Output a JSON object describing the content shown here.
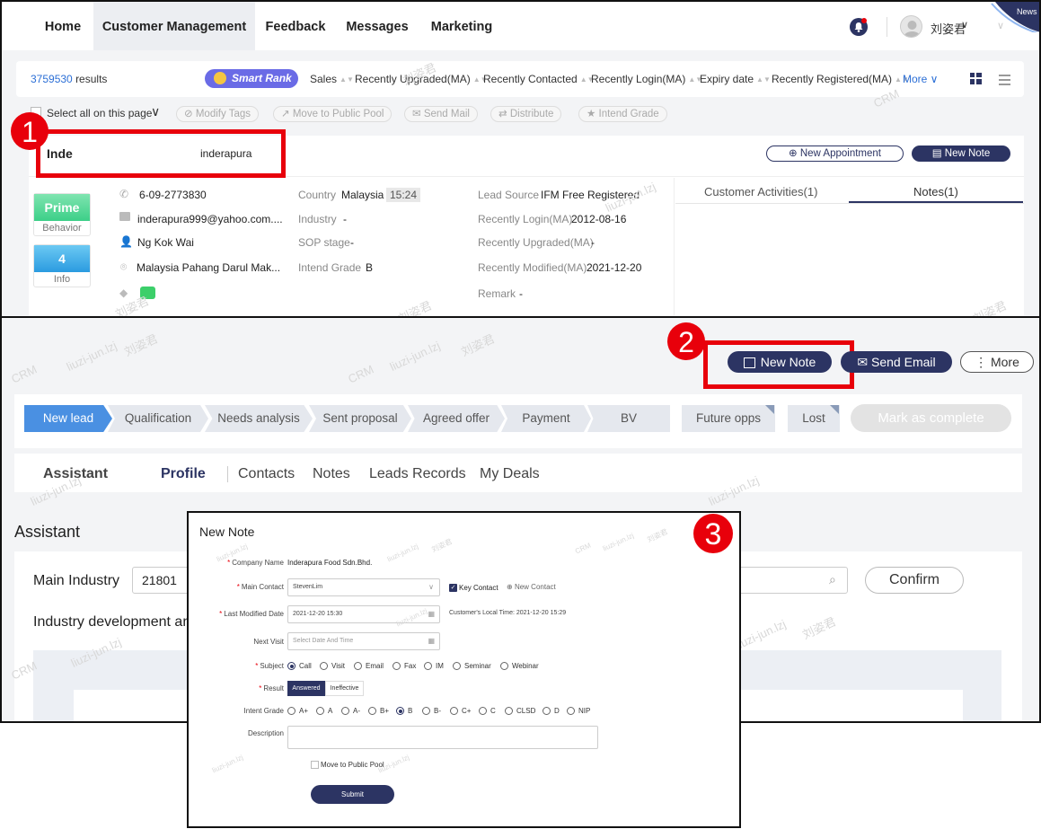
{
  "panel1": {
    "nav": {
      "tabs": [
        "Home",
        "Customer Management",
        "Feedback",
        "Messages",
        "Marketing"
      ],
      "news_label": "News",
      "user_name": "刘姿君"
    },
    "toolbar": {
      "results_count": "3759530",
      "results_label": "results",
      "smart_rank_label": "Smart Rank",
      "sort_options": [
        "Sales",
        "Recently Upgraded(MA)",
        "Recently Contacted",
        "Recently Login(MA)",
        "Expiry date",
        "Recently Registered(MA)"
      ],
      "more_label": "More"
    },
    "bulk": {
      "select_all_label": "Select all on this page",
      "actions": [
        "Modify Tags",
        "Move to Public Pool",
        "Send Mail",
        "Distribute",
        "Intend Grade"
      ]
    },
    "customer": {
      "name_short": "Inde",
      "name_full": "inderapura",
      "new_appointment_label": "New Appointment",
      "new_note_label": "New Note",
      "prime_label": "Prime",
      "behavior_label": "Behavior",
      "info_count": "4",
      "info_label": "Info",
      "phone": "6-09-2773830",
      "email": "inderapura999@yahoo.com....",
      "contact_name": "Ng Kok Wai",
      "address": "Malaysia Pahang Darul Mak...",
      "country_label": "Country",
      "country_value": "Malaysia",
      "local_time": "15:24",
      "industry_label": "Industry",
      "industry_value": "-",
      "sop_label": "SOP stage",
      "sop_value": "-",
      "intend_label": "Intend Grade",
      "intend_value": "B",
      "lead_source_label": "Lead Source",
      "lead_source_value": "IFM Free Registered",
      "recent_login_label": "Recently Login(MA)",
      "recent_login_value": "2012-08-16",
      "recent_upgraded_label": "Recently Upgraded(MA)",
      "recent_upgraded_value": "-",
      "recent_modified_label": "Recently Modified(MA)",
      "recent_modified_value": "2021-12-20",
      "remark_label": "Remark",
      "remark_value": "-",
      "tab_activities": "Customer Activities(1)",
      "tab_notes": "Notes(1)"
    },
    "step_badge": "1"
  },
  "panel2": {
    "step_badge": "2",
    "actions": {
      "new_note": "New Note",
      "send_email": "Send Email",
      "more": "More"
    },
    "stages": [
      "New lead",
      "Qualification",
      "Needs analysis",
      "Sent proposal",
      "Agreed offer",
      "Payment",
      "BV"
    ],
    "future_opps": "Future opps",
    "lost": "Lost",
    "mark_complete": "Mark as complete",
    "subtabs": {
      "assistant": "Assistant",
      "profile": "Profile",
      "others": [
        "Contacts",
        "Notes",
        "Leads Records",
        "My Deals"
      ]
    },
    "section_title": "Assistant",
    "main_industry_label": "Main Industry",
    "main_industry_value": "21801",
    "confirm_label": "Confirm",
    "industry_dev_label": "Industry development an"
  },
  "panel3": {
    "step_badge": "3",
    "title": "New Note",
    "company_label": "Company Name",
    "company_value": "Inderapura Food Sdn.Bhd.",
    "main_contact_label": "Main Contact",
    "main_contact_value": "StevenLim",
    "key_contact_label": "Key Contact",
    "new_contact_label": "New Contact",
    "last_modified_label": "Last Modified Date",
    "last_modified_value": "2021-12-20 15:30",
    "local_time_text": "Customer's Local Time: 2021-12-20 15:29",
    "next_visit_label": "Next Visit",
    "next_visit_placeholder": "Select Date And Time",
    "subject_label": "Subject",
    "subject_options": [
      "Call",
      "Visit",
      "Email",
      "Fax",
      "IM",
      "Seminar",
      "Webinar"
    ],
    "result_label": "Result",
    "result_answered": "Answered",
    "result_ineffective": "Ineffective",
    "intent_label": "Intent Grade",
    "intent_options": [
      "A+",
      "A",
      "A-",
      "B+",
      "B",
      "B-",
      "C+",
      "C",
      "CLSD",
      "D",
      "NIP"
    ],
    "description_label": "Description",
    "move_pool_label": "Move to Public Pool",
    "submit_label": "Submit"
  },
  "watermark": {
    "crm": "CRM",
    "user": "liuzi-jun.lzj",
    "cn": "刘姿君"
  },
  "colors": {
    "accent_dark": "#2c3463",
    "highlight_red": "#e8000b",
    "stage_active": "#4a90e2",
    "prime_green": "#5fd99a",
    "info_blue": "#3aa4e6"
  }
}
